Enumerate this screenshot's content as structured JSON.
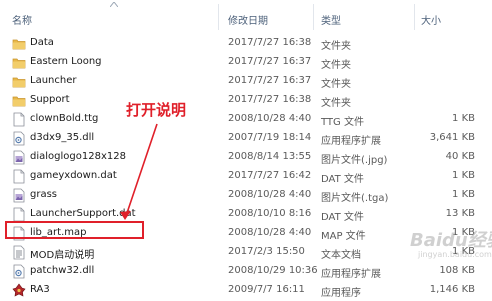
{
  "columns": {
    "name": "名称",
    "date": "修改日期",
    "type": "类型",
    "size": "大小"
  },
  "files": [
    {
      "name": "Data",
      "date": "2017/7/27 16:38",
      "type": "文件夹",
      "size": "",
      "icon": "folder-icon"
    },
    {
      "name": "Eastern Loong",
      "date": "2017/7/27 16:37",
      "type": "文件夹",
      "size": "",
      "icon": "folder-icon"
    },
    {
      "name": "Launcher",
      "date": "2017/7/27 16:37",
      "type": "文件夹",
      "size": "",
      "icon": "folder-icon"
    },
    {
      "name": "Support",
      "date": "2017/7/27 16:38",
      "type": "文件夹",
      "size": "",
      "icon": "folder-icon"
    },
    {
      "name": "clownBold.ttg",
      "date": "2008/10/28 4:40",
      "type": "TTG 文件",
      "size": "1 KB",
      "icon": "file-icon"
    },
    {
      "name": "d3dx9_35.dll",
      "date": "2007/7/19 18:14",
      "type": "应用程序扩展",
      "size": "3,641 KB",
      "icon": "dll-icon"
    },
    {
      "name": "dialoglogo128x128",
      "date": "2008/8/14 13:55",
      "type": "图片文件(.jpg)",
      "size": "40 KB",
      "icon": "image-icon"
    },
    {
      "name": "gameyxdown.dat",
      "date": "2017/7/27 16:42",
      "type": "DAT 文件",
      "size": "1 KB",
      "icon": "file-icon"
    },
    {
      "name": "grass",
      "date": "2008/10/28 4:40",
      "type": "图片文件(.tga)",
      "size": "1 KB",
      "icon": "image-icon"
    },
    {
      "name": "LauncherSupport.dat",
      "date": "2008/10/10 8:16",
      "type": "DAT 文件",
      "size": "13 KB",
      "icon": "file-icon"
    },
    {
      "name": "lib_art.map",
      "date": "2008/10/28 4:40",
      "type": "MAP 文件",
      "size": "1 KB",
      "icon": "file-icon"
    },
    {
      "name": "MOD启动说明",
      "date": "2017/2/3 15:50",
      "type": "文本文档",
      "size": "1 KB",
      "icon": "text-file-icon"
    },
    {
      "name": "patchw32.dll",
      "date": "2008/10/29 10:36",
      "type": "应用程序扩展",
      "size": "108 KB",
      "icon": "dll-icon"
    },
    {
      "name": "RA3",
      "date": "2009/7/7 16:11",
      "type": "应用程序",
      "size": "1,146 KB",
      "icon": "app-icon"
    }
  ],
  "annotation": {
    "text": "打开说明",
    "color": "#e0202a"
  },
  "watermark": {
    "logo": "Baidu经验",
    "url": "jingyan.baidu.com"
  },
  "colors": {
    "header_text": "#4c607a",
    "folder": "#e8b84a",
    "selection": "#d9e8fb",
    "accent_red": "#e0202a"
  }
}
